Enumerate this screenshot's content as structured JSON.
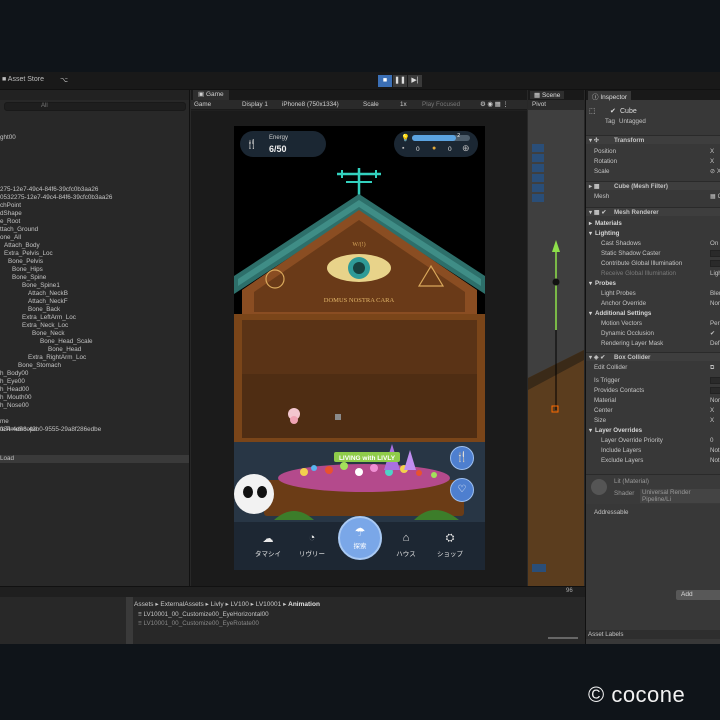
{
  "topbar": {
    "asset_store": "Asset Store"
  },
  "hierarchy": {
    "search_placeholder": "All",
    "rows": [
      "ght00",
      "275-12e7-49c4-84f6-39cfc0b3aa26",
      "0532275-12e7-49c4-84f6-39cfc0b3aa26",
      "chPoint",
      "dShape",
      "e_Root",
      "ttach_Ground",
      "one_All",
      "Attach_Body",
      "Extra_Pelvis_Loc",
      "Bone_Pelvis",
      "Bone_Hips",
      "Bone_Spine",
      "Bone_Spine1",
      "Attach_NeckB",
      "Attach_NeckF",
      "Bone_Back",
      "Extra_LeftArm_Loc",
      "Extra_Neck_Loc",
      "Bone_Neck",
      "Bone_Head_Scale",
      "Bone_Head",
      "Extra_RightArm_Loc",
      "Bone_Stomach",
      "h_Body00",
      "h_Eye00",
      "h_Head00",
      "h_Mouth00",
      "h_Nose00",
      "me",
      "feTimeScope",
      "d34-4de8-42b0-9555-29a8f286edbe"
    ],
    "section_load": "Load"
  },
  "game": {
    "tab": "Game",
    "mode": "Game",
    "display": "Display 1",
    "resolution": "iPhone8 (750x1334)",
    "scale_label": "Scale",
    "scale_value": "1x",
    "play_focused": "Play Focused",
    "energy_label": "Energy",
    "energy_value": "6/50",
    "status_bar_fill": 0.75,
    "status_bar_value": "2",
    "count_a": "0",
    "count_b": "0",
    "sign_text": "DOMUS NOSTRA CARA",
    "banner_text": "LIVING with LIVLY",
    "nav": [
      {
        "label": "タマシイ",
        "icon": "soul-icon"
      },
      {
        "label": "リヴリー",
        "icon": "livly-icon"
      },
      {
        "label": "探索",
        "icon": "explore-icon"
      },
      {
        "label": "ハウス",
        "icon": "house-icon"
      },
      {
        "label": "ショップ",
        "icon": "shop-icon"
      }
    ]
  },
  "scene": {
    "tab": "Scene",
    "pivot": "Pivot"
  },
  "inspector": {
    "tab": "Inspector",
    "object_name": "Cube",
    "tag_label": "Tag",
    "tag_value": "Untagged",
    "transform": "Transform",
    "position": "Position",
    "rotation": "Rotation",
    "scale": "Scale",
    "mesh_filter": "Cube (Mesh Filter)",
    "mesh_label": "Mesh",
    "mesh_renderer": "Mesh Renderer",
    "materials": "Materials",
    "lighting": "Lighting",
    "cast_shadows": "Cast Shadows",
    "cast_shadows_val": "On",
    "static_shadow": "Static Shadow Caster",
    "contribute_gi": "Contribute Global Illumination",
    "receive_gi": "Receive Global Illumination",
    "receive_gi_val": "Ligh",
    "probes": "Probes",
    "light_probes": "Light Probes",
    "light_probes_val": "Blen",
    "anchor_override": "Anchor Override",
    "anchor_override_val": "Non",
    "additional_settings": "Additional Settings",
    "motion_vectors": "Motion Vectors",
    "motion_vectors_val": "Per",
    "dynamic_occlusion": "Dynamic Occlusion",
    "rendering_layer_mask": "Rendering Layer Mask",
    "rendering_layer_mask_val": "Def",
    "box_collider": "Box Collider",
    "edit_collider": "Edit Collider",
    "is_trigger": "Is Trigger",
    "provides_contacts": "Provides Contacts",
    "material": "Material",
    "material_val": "Non",
    "center": "Center",
    "size": "Size",
    "layer_overrides": "Layer Overrides",
    "layer_override_priority": "Layer Override Priority",
    "layer_override_priority_val": "0",
    "include_layers": "Include Layers",
    "include_layers_val": "Not",
    "exclude_layers": "Exclude Layers",
    "exclude_layers_val": "Not",
    "material_name": "Lit (Material)",
    "shader_label": "Shader",
    "shader_val": "Universal Render Pipeline/Li",
    "addressable": "Addressable",
    "add_component": "Add",
    "asset_labels": "Asset Labels"
  },
  "project": {
    "breadcrumb": [
      "Assets",
      "ExternalAssets",
      "Livly",
      "LV100",
      "LV10001"
    ],
    "breadcrumb_last": "Animation",
    "assets": [
      "LV10001_00_Customize00_EyeHorizontal00",
      "LV10001_00_Customize00_EyeRotate00"
    ],
    "count": "96"
  },
  "copyright": "© cocone"
}
